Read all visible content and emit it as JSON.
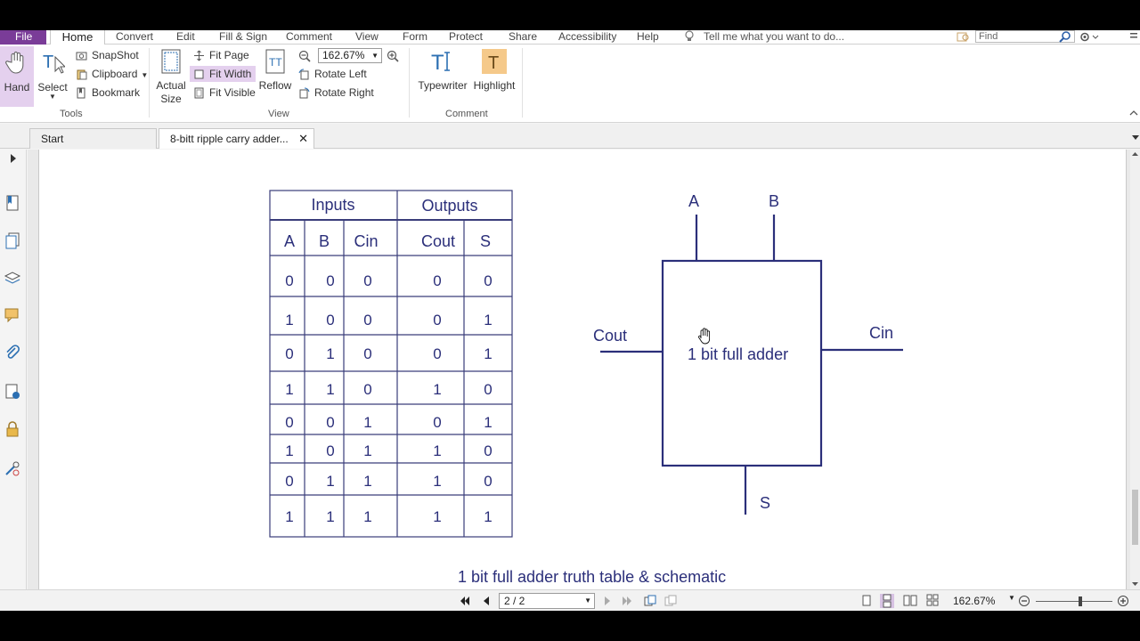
{
  "menubar": {
    "file": "File",
    "home": "Home",
    "items": [
      "Convert",
      "Edit",
      "Fill & Sign",
      "Comment",
      "View",
      "Form",
      "Protect",
      "Share",
      "Accessibility",
      "Help"
    ],
    "tell_me": "Tell me what you want to do...",
    "find_placeholder": "Find"
  },
  "ribbon": {
    "hand": "Hand",
    "select": "Select",
    "snapshot": "SnapShot",
    "clipboard": "Clipboard",
    "bookmark": "Bookmark",
    "tools_group": "Tools",
    "actual_size_1": "Actual",
    "actual_size_2": "Size",
    "fit_page": "Fit Page",
    "fit_width": "Fit Width",
    "fit_visible": "Fit Visible",
    "reflow": "Reflow",
    "zoom": "162.67%",
    "rotate_left": "Rotate Left",
    "rotate_right": "Rotate Right",
    "view_group": "View",
    "typewriter": "Typewriter",
    "highlight": "Highlight",
    "comment_group": "Comment"
  },
  "tabs": {
    "start": "Start",
    "doc": "8-bitt ripple carry adder..."
  },
  "truth_table": {
    "group_headers": [
      "Inputs",
      "Outputs"
    ],
    "columns": [
      "A",
      "B",
      "Cin",
      "Cout",
      "S"
    ],
    "rows": [
      [
        "0",
        "0",
        "0",
        "0",
        "0"
      ],
      [
        "1",
        "0",
        "0",
        "0",
        "1"
      ],
      [
        "0",
        "1",
        "0",
        "0",
        "1"
      ],
      [
        "1",
        "1",
        "0",
        "1",
        "0"
      ],
      [
        "0",
        "0",
        "1",
        "0",
        "1"
      ],
      [
        "1",
        "0",
        "1",
        "1",
        "0"
      ],
      [
        "0",
        "1",
        "1",
        "1",
        "0"
      ],
      [
        "1",
        "1",
        "1",
        "1",
        "1"
      ]
    ]
  },
  "schematic": {
    "a": "A",
    "b": "B",
    "cout": "Cout",
    "cin": "Cin",
    "block": "1 bit full adder",
    "s": "S"
  },
  "caption": "1 bit full adder truth table & schematic",
  "statusbar": {
    "page": "2 / 2",
    "zoom": "162.67%"
  },
  "colors": {
    "accent": "#7a3c98",
    "ink": "#2b2f7a"
  }
}
